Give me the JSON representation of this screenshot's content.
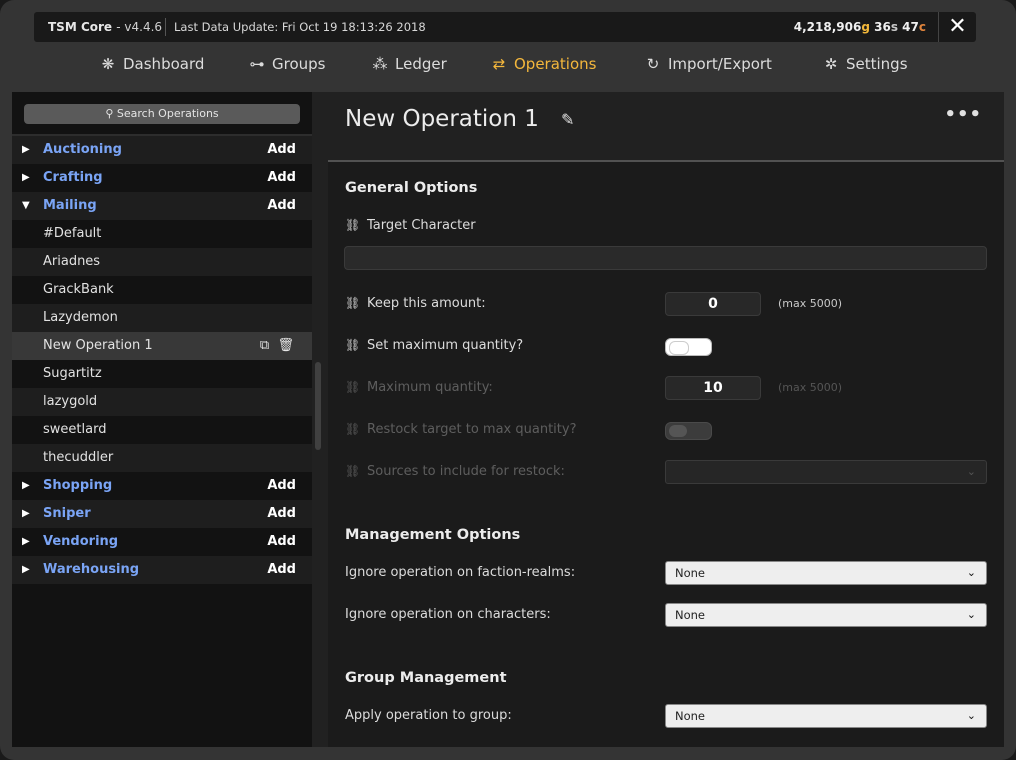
{
  "header": {
    "app_name": "TSM Core",
    "version": "- v4.4.6",
    "last_update": "Last Data Update: Fri Oct 19 18:13:26 2018",
    "gold": "4,218,906",
    "gold_unit": "g",
    "silver": "36",
    "silver_unit": "s",
    "copper": "47",
    "copper_unit": "c",
    "close_glyph": "✕"
  },
  "nav": [
    {
      "label": "Dashboard",
      "icon": "dashboard-icon"
    },
    {
      "label": "Groups",
      "icon": "groups-icon"
    },
    {
      "label": "Ledger",
      "icon": "ledger-icon"
    },
    {
      "label": "Operations",
      "icon": "operations-icon",
      "active": true
    },
    {
      "label": "Import/Export",
      "icon": "import-export-icon"
    },
    {
      "label": "Settings",
      "icon": "settings-icon"
    }
  ],
  "sidebar": {
    "search_placeholder": "Search Operations",
    "add_label": "Add",
    "categories": {
      "auctioning": "Auctioning",
      "crafting": "Crafting",
      "mailing": "Mailing",
      "shopping": "Shopping",
      "sniper": "Sniper",
      "vendoring": "Vendoring",
      "warehousing": "Warehousing"
    },
    "mailing_ops": [
      "#Default",
      "Ariadnes",
      "GrackBank",
      "Lazydemon",
      "New Operation 1",
      "Sugartitz",
      "lazygold",
      "sweetlard",
      "thecuddler"
    ]
  },
  "main": {
    "title": "New Operation 1",
    "more_glyph": "•••",
    "general": {
      "title": "General Options",
      "target_character": "Target Character",
      "keep_amount": "Keep this amount:",
      "keep_value": "0",
      "keep_max": "(max 5000)",
      "set_max_qty": "Set maximum quantity?",
      "max_qty": "Maximum quantity:",
      "max_qty_value": "10",
      "max_qty_max": "(max 5000)",
      "restock": "Restock target to max quantity?",
      "sources": "Sources to include for restock:"
    },
    "management": {
      "title": "Management Options",
      "ignore_realms": "Ignore operation on faction-realms:",
      "ignore_realms_value": "None",
      "ignore_chars": "Ignore operation on characters:",
      "ignore_chars_value": "None"
    },
    "group": {
      "title": "Group Management",
      "apply": "Apply operation to group:",
      "apply_value": "None"
    }
  }
}
